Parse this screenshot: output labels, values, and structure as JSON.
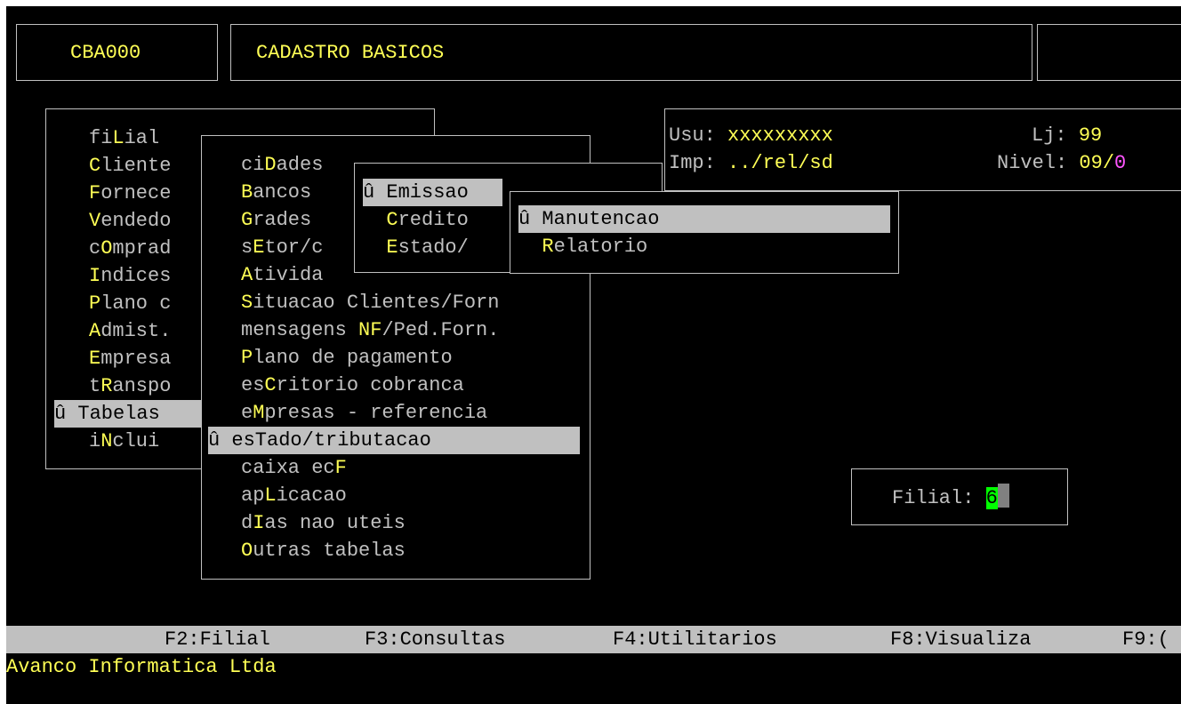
{
  "header": {
    "program_code": "CBA000",
    "title": "CADASTRO BASICOS"
  },
  "user_info": {
    "usu_label": "Usu: ",
    "usu_value": "xxxxxxxxx",
    "lj_label": "Lj: ",
    "lj_value": "99",
    "imp_label": "Imp: ",
    "imp_value": "../rel/sd",
    "nivel_label": "Nivel: ",
    "nivel_value": "09/",
    "nivel_extra": "0"
  },
  "main_menu": {
    "items": [
      {
        "pre": "fi",
        "hot": "L",
        "post": "ial"
      },
      {
        "pre": "",
        "hot": "C",
        "post": "liente"
      },
      {
        "pre": "",
        "hot": "F",
        "post": "ornece"
      },
      {
        "pre": "",
        "hot": "V",
        "post": "endedo"
      },
      {
        "pre": "c",
        "hot": "O",
        "post": "mprad"
      },
      {
        "pre": "",
        "hot": "I",
        "post": "ndices"
      },
      {
        "pre": "",
        "hot": "P",
        "post": "lano c"
      },
      {
        "pre": "",
        "hot": "A",
        "post": "dmist."
      },
      {
        "pre": "",
        "hot": "E",
        "post": "mpresa"
      },
      {
        "pre": "t",
        "hot": "R",
        "post": "anspo"
      },
      {
        "pre": "û Tabelas",
        "hot": "",
        "post": ""
      },
      {
        "pre": "i",
        "hot": "N",
        "post": "clui"
      }
    ]
  },
  "tabelas_menu": {
    "items": [
      {
        "pre": "ci",
        "hot": "D",
        "post": "ades"
      },
      {
        "pre": "",
        "hot": "B",
        "post": "ancos"
      },
      {
        "pre": "",
        "hot": "G",
        "post": "rades"
      },
      {
        "pre": "s",
        "hot": "E",
        "post": "tor/c"
      },
      {
        "pre": "",
        "hot": "A",
        "post": "tivida"
      },
      {
        "pre": "",
        "hot": "S",
        "post": "ituacao Clientes/Forn"
      },
      {
        "pre": "mensagens ",
        "hot": "NF",
        "post": "/Ped.Forn."
      },
      {
        "pre": "",
        "hot": "P",
        "post": "lano de pagamento"
      },
      {
        "pre": "es",
        "hot": "C",
        "post": "ritorio cobranca"
      },
      {
        "pre": "e",
        "hot": "M",
        "post": "presas - referencia"
      },
      {
        "pre": "û esTado/tributacao",
        "hot": "",
        "post": ""
      },
      {
        "pre": "caixa ec",
        "hot": "F",
        "post": ""
      },
      {
        "pre": "ap",
        "hot": "L",
        "post": "icacao"
      },
      {
        "pre": "d",
        "hot": "I",
        "post": "as nao uteis"
      },
      {
        "pre": "",
        "hot": "O",
        "post": "utras tabelas"
      }
    ]
  },
  "estado_menu": {
    "items": [
      {
        "pre": "û Emissao",
        "hot": "",
        "post": ""
      },
      {
        "pre": "  ",
        "hot": "C",
        "post": "redito"
      },
      {
        "pre": "  ",
        "hot": "E",
        "post": "stado/"
      }
    ]
  },
  "emissao_menu": {
    "items": [
      {
        "pre": "û Manutencao",
        "hot": "",
        "post": ""
      },
      {
        "pre": "  ",
        "hot": "R",
        "post": "elatorio"
      }
    ]
  },
  "filial": {
    "label": "Filial: ",
    "value": "6"
  },
  "function_keys": [
    {
      "label": "F2:Filial"
    },
    {
      "label": "F3:Consultas"
    },
    {
      "label": "F4:Utilitarios"
    },
    {
      "label": "F8:Visualiza"
    },
    {
      "label": "F9:("
    }
  ],
  "footer": {
    "company": "Avanco Informatica Ltda"
  }
}
